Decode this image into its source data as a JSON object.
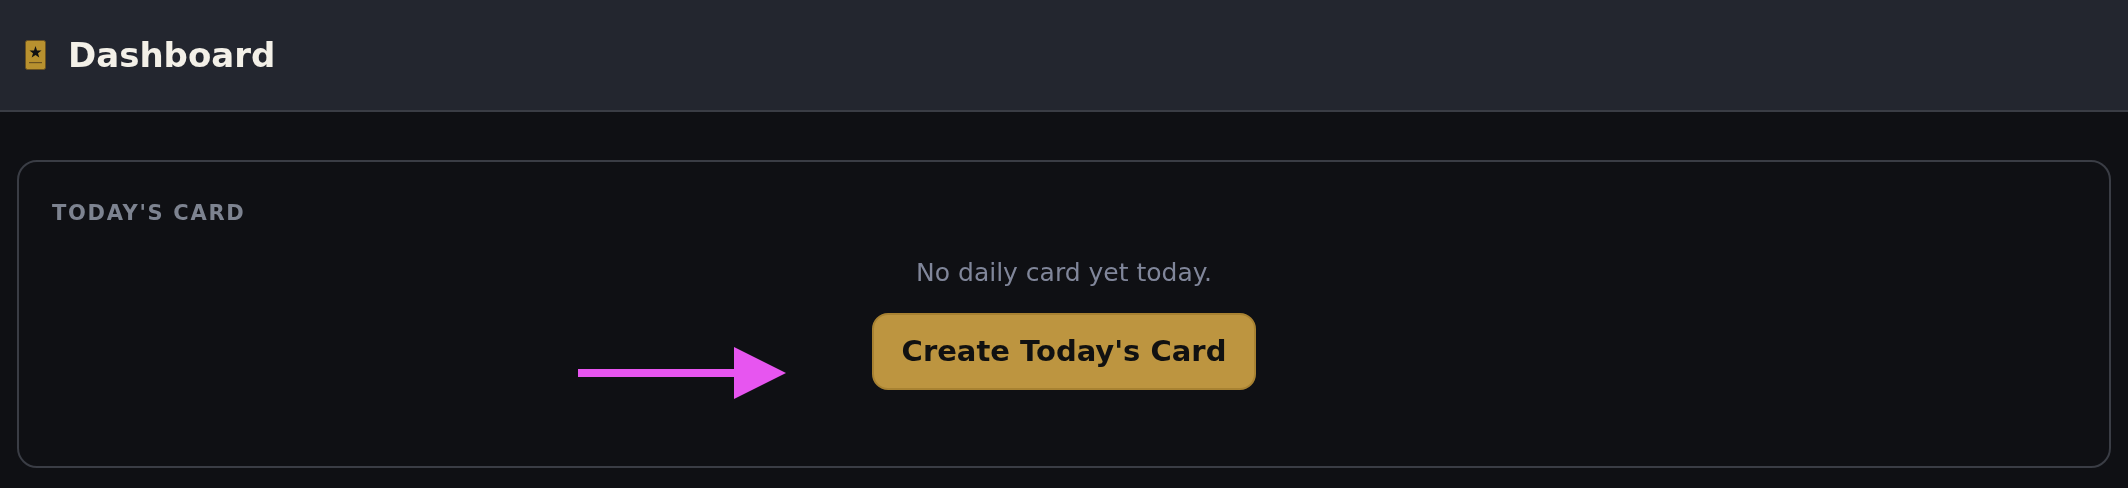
{
  "header": {
    "title": "Dashboard"
  },
  "card": {
    "heading": "TODAY'S CARD",
    "message": "No daily card yet today.",
    "button": "Create Today's Card"
  }
}
